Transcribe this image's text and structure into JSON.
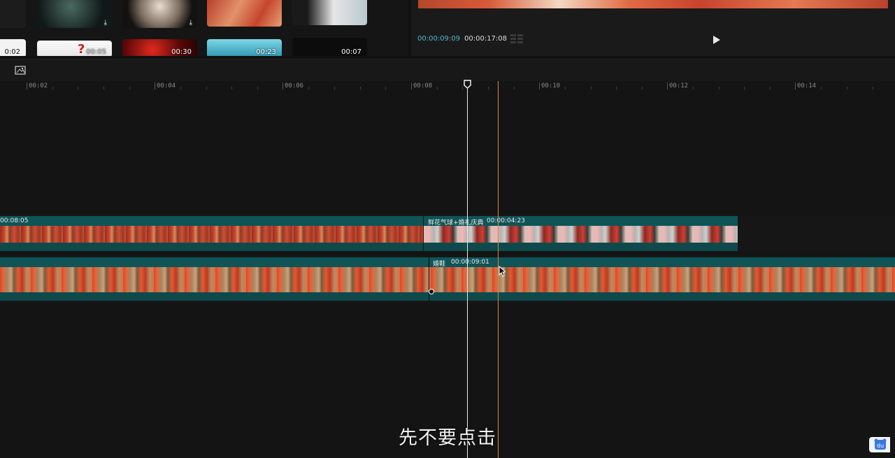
{
  "media": {
    "thumbs_top": [
      {
        "name": "thumb-dark-smoke",
        "has_download": true,
        "colors": [
          "#1d2a2a",
          "#324a44"
        ]
      },
      {
        "name": "thumb-explosion-smoke",
        "has_download": true,
        "colors": [
          "#2a2420",
          "#d2c7b8"
        ]
      },
      {
        "name": "thumb-red-shoes",
        "has_download": false,
        "colors": [
          "#c6442f",
          "#e3936a"
        ]
      },
      {
        "name": "thumb-wedding-couple",
        "has_download": false,
        "colors": [
          "#222",
          "#eeeeee"
        ]
      }
    ],
    "thumbs_bottom": [
      {
        "duration": "0:02",
        "colors": [
          "#ffffff",
          "#222"
        ]
      },
      {
        "duration": "00:05",
        "colors": [
          "#f5f5f5",
          "#e0e0e0"
        ]
      },
      {
        "duration": "00:30",
        "colors": [
          "#3a0606",
          "#d0221b"
        ]
      },
      {
        "duration": "00:23",
        "colors": [
          "#59c5d8",
          "#2c8ea8"
        ]
      },
      {
        "duration": "00:07",
        "colors": [
          "#0a0a0a",
          "#151515"
        ]
      }
    ]
  },
  "preview": {
    "current_time": "00:00:09:09",
    "total_time": "00:00:17:08"
  },
  "ruler": {
    "labels": [
      "00:02",
      "00:04",
      "00:06",
      "00:08",
      "00:10",
      "00:12",
      "00:14"
    ]
  },
  "tracks": {
    "overlay": {
      "clip_a_duration": "00:08:05",
      "clip_b_name": "鲜花气球+婚礼庆典",
      "clip_b_duration": "00:00:04:23"
    },
    "main": {
      "clip_name": "婚鞋",
      "clip_duration": "00:00:09:01"
    }
  },
  "subtitle": "先不要点击",
  "colors": {
    "accent_time": "#4fb8c8",
    "clip_header": "#0f5457",
    "hover_line": "#d9863a",
    "playhead": "#e8e8e8"
  }
}
